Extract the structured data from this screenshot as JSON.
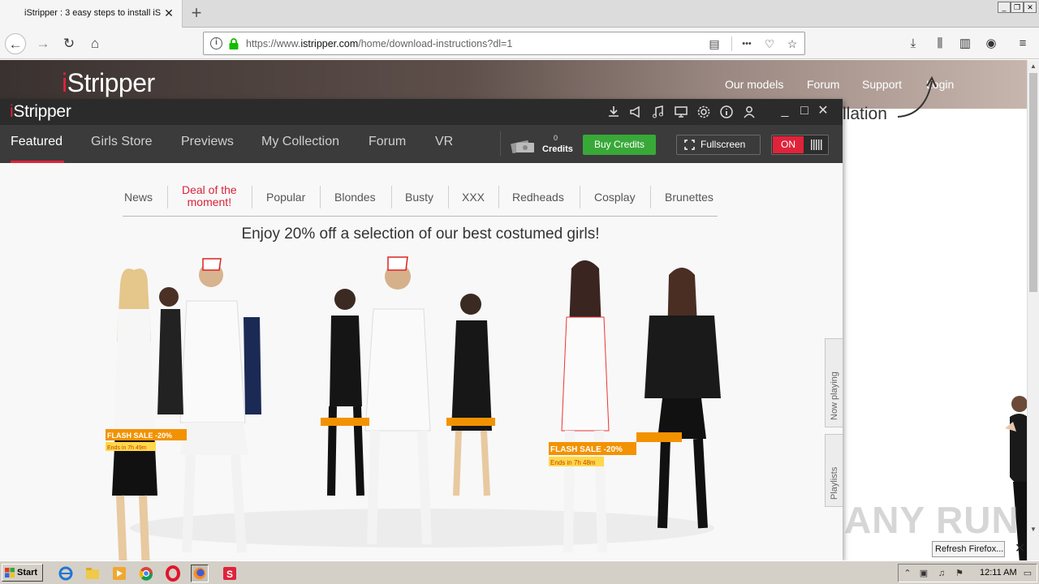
{
  "browser": {
    "tab_title": "iStripper : 3 easy steps to install iS",
    "url_prefix": "https://www.",
    "url_host": "istripper.com",
    "url_path": "/home/download-instructions?dl=1",
    "url_more": "•••"
  },
  "website": {
    "logo_i": "i",
    "logo_rest": "Stripper",
    "nav": [
      "Our models",
      "Forum",
      "Support",
      "Login"
    ],
    "heading_fragment": "llation",
    "watermark": "ANY RUN",
    "refresh_button": "Refresh Firefox..."
  },
  "app": {
    "logo_i": "i",
    "logo_rest": "Stripper",
    "tabs": [
      "Featured",
      "Girls Store",
      "Previews",
      "My Collection",
      "Forum",
      "VR"
    ],
    "active_tab": "Featured",
    "credits_count": "0",
    "credits_label": "Credits",
    "buy_credits": "Buy Credits",
    "fullscreen": "Fullscreen",
    "toggle_on": "ON",
    "categories": [
      "News",
      "Deal of the moment!",
      "Popular",
      "Blondes",
      "Busty",
      "XXX",
      "Redheads",
      "Cosplay",
      "Brunettes"
    ],
    "deal_line1": "Deal of the",
    "deal_line2": "moment!",
    "promo_text": "Enjoy 20% off a selection of our best costumed girls!",
    "sale_badges": [
      {
        "label": "FLASH SALE -20%",
        "ends": "Ends in 7h 49m"
      },
      {
        "label": "FLASH SALE -20%",
        "ends": "Ends in 7h 48m"
      }
    ],
    "side_tabs": [
      "Now playing",
      "Playlists"
    ]
  },
  "taskbar": {
    "start": "Start",
    "clock": "12:11 AM"
  },
  "colors": {
    "accent_red": "#e0233a",
    "buy_green": "#38a838",
    "app_dark": "#2b2b2b",
    "nav_dark": "#3b3b3b",
    "sale_orange": "#f39200"
  }
}
